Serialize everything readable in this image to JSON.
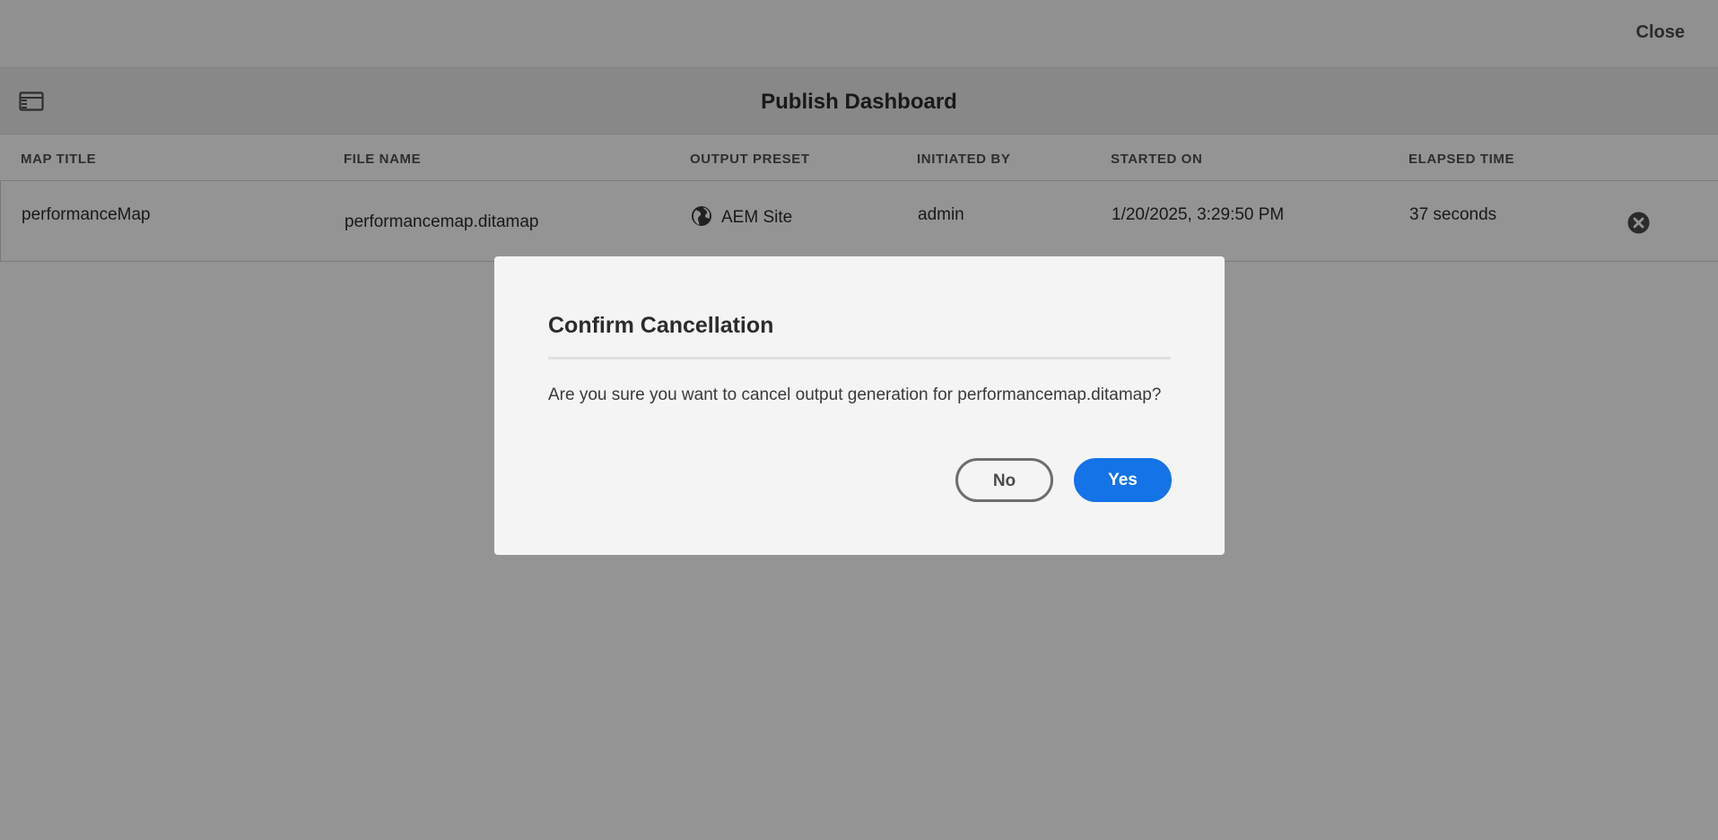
{
  "topbar": {
    "close_label": "Close"
  },
  "dashboard": {
    "title": "Publish Dashboard",
    "columns": [
      "MAP TITLE",
      "FILE NAME",
      "OUTPUT PRESET",
      "INITIATED BY",
      "STARTED ON",
      "ELAPSED TIME"
    ],
    "rows": [
      {
        "map_title": "performanceMap",
        "file_name": "performancemap.ditamap",
        "output_preset": "AEM Site",
        "output_preset_icon": "globe-icon",
        "initiated_by": "admin",
        "started_on": "1/20/2025, 3:29:50 PM",
        "elapsed_time": "37 seconds"
      }
    ]
  },
  "dialog": {
    "title": "Confirm Cancellation",
    "message": "Are you sure you want to cancel output generation for performancemap.ditamap?",
    "no_label": "No",
    "yes_label": "Yes"
  },
  "colors": {
    "accent": "#1473e6",
    "overlay": "rgba(0,0,0,0.42)"
  }
}
